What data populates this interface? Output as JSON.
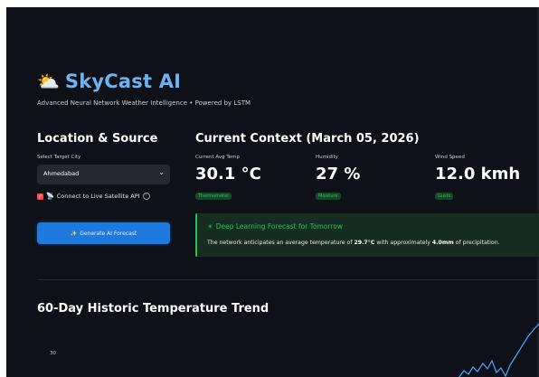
{
  "brand": {
    "icon": "⛅",
    "icon_name": "sun-behind-cloud-icon",
    "title": "SkyCast AI",
    "subtitle": "Advanced Neural Network Weather Intelligence • Powered by LSTM"
  },
  "sidebar": {
    "heading": "Location & Source",
    "city_label": "Select Target City",
    "city_value": "Ahmedabad",
    "satellite_label": "Connect to Live Satellite API",
    "satellite_checked": true,
    "generate_label": "Generate AI Forecast"
  },
  "context": {
    "heading": "Current Context (March 05, 2026)",
    "metrics": [
      {
        "label": "Current Avg Temp",
        "value": "30.1 °C",
        "tag": "Thermometer"
      },
      {
        "label": "Humidity",
        "value": "27 %",
        "tag": "Moisture"
      },
      {
        "label": "Wind Speed",
        "value": "12.0 kmh",
        "tag": "Gusts"
      }
    ]
  },
  "forecast": {
    "title": "Deep Learning Forecast for Tomorrow",
    "body_prefix": "The network anticipates an average temperature of ",
    "temp": "29.7°C",
    "body_mid": " with approximately ",
    "precip": "4.0mm",
    "body_suffix": " of precipitation."
  },
  "trend": {
    "heading": "60-Day Historic Temperature Trend",
    "ytick": "30"
  },
  "colors": {
    "accent_blue": "#1f7ae0",
    "brand_blue": "#6db3f2",
    "success_green": "#21c354",
    "checkbox_red": "#ff4b4b",
    "background": "#0e1117"
  }
}
